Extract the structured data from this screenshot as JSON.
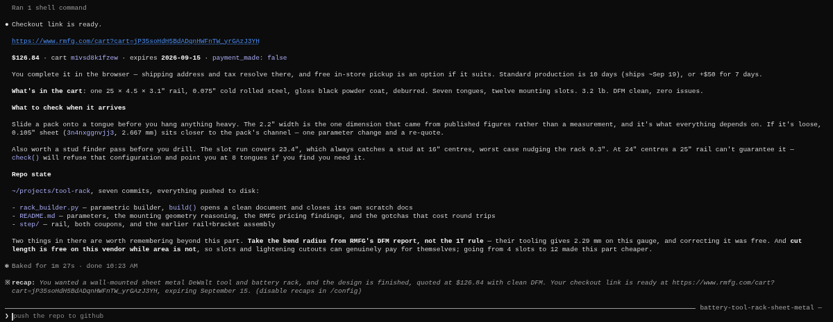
{
  "header": "Ran 1 shell command",
  "blocks": [
    {
      "kind": "bullet",
      "glyph": "●",
      "segments": [
        {
          "kind": "plain",
          "text": "Checkout link is ready."
        }
      ]
    },
    {
      "kind": "link",
      "text": "https://www.rmfg.com/cart?cart=jP35soHdH5BdADqnHWFnTW_yrGAzJ3YH"
    },
    {
      "kind": "para",
      "segments": [
        {
          "kind": "bold",
          "text": "$126.84"
        },
        {
          "kind": "plain",
          "text": " · cart "
        },
        {
          "kind": "code",
          "text": "m1vsd8k1fzew"
        },
        {
          "kind": "plain",
          "text": " · expires "
        },
        {
          "kind": "bold",
          "text": "2026-09-15"
        },
        {
          "kind": "plain",
          "text": " · "
        },
        {
          "kind": "code",
          "text": "payment_made: false"
        }
      ]
    },
    {
      "kind": "para",
      "segments": [
        {
          "kind": "plain",
          "text": "You complete it in the browser — shipping address and tax resolve there, and free in-store pickup is an option if it suits. Standard production is 10 days (ships ~Sep 19), or +$50 for 7 days."
        }
      ]
    },
    {
      "kind": "para",
      "segments": [
        {
          "kind": "bold",
          "text": "What's in the cart"
        },
        {
          "kind": "plain",
          "text": ": one 25 × 4.5 × 3.1\" rail, 0.075\" cold rolled steel, gloss black powder coat, deburred. Seven tongues, twelve mounting slots. 3.2 lb. DFM clean, zero issues."
        }
      ]
    },
    {
      "kind": "heading",
      "text": "What to check when it arrives"
    },
    {
      "kind": "para",
      "segments": [
        {
          "kind": "plain",
          "text": "Slide a pack onto a tongue before you hang anything heavy. The 2.2\" width is the one dimension that came from published figures rather than a measurement, and it's what everything depends on. If it's loose, 0.105\" sheet ("
        },
        {
          "kind": "code",
          "text": "3n4nxggnvjj3"
        },
        {
          "kind": "plain",
          "text": ", 2.667 mm) sits closer to the pack's channel — one parameter change and a re-quote."
        }
      ]
    },
    {
      "kind": "para",
      "segments": [
        {
          "kind": "plain",
          "text": "Also worth a stud finder pass before you drill. The slot run covers 23.4\", which always catches a stud at 16\" centres, worst case nudging the rack 0.3\". At 24\" centres a 25\" rail can't guarantee it — "
        },
        {
          "kind": "code",
          "text": "check()"
        },
        {
          "kind": "plain",
          "text": " will refuse that configuration and point you at 8 tongues if you find you need it."
        }
      ]
    },
    {
      "kind": "heading",
      "text": "Repo state"
    },
    {
      "kind": "para",
      "segments": [
        {
          "kind": "code",
          "text": "~/projects/tool-rack"
        },
        {
          "kind": "plain",
          "text": ", seven commits, everything pushed to disk:"
        }
      ]
    },
    {
      "kind": "list",
      "items": [
        {
          "segments": [
            {
              "kind": "plain",
              "text": "- "
            },
            {
              "kind": "code",
              "text": "rack_builder.py"
            },
            {
              "kind": "plain",
              "text": " — parametric builder, "
            },
            {
              "kind": "code",
              "text": "build()"
            },
            {
              "kind": "plain",
              "text": " opens a clean document and closes its own scratch docs"
            }
          ]
        },
        {
          "segments": [
            {
              "kind": "plain",
              "text": "- "
            },
            {
              "kind": "code",
              "text": "README.md"
            },
            {
              "kind": "plain",
              "text": " — parameters, the mounting geometry reasoning, the RMFG pricing findings, and the gotchas that cost round trips"
            }
          ]
        },
        {
          "segments": [
            {
              "kind": "plain",
              "text": "- "
            },
            {
              "kind": "code",
              "text": "step/"
            },
            {
              "kind": "plain",
              "text": " — rail, both coupons, and the earlier rail+bracket assembly"
            }
          ]
        }
      ]
    },
    {
      "kind": "para",
      "segments": [
        {
          "kind": "plain",
          "text": "Two things in there are worth remembering beyond this part. "
        },
        {
          "kind": "bold",
          "text": "Take the bend radius from RMFG's DFM report, not the 1T rule"
        },
        {
          "kind": "plain",
          "text": " — their tooling gives 2.29 mm on this gauge, and correcting it was free. And "
        },
        {
          "kind": "bold",
          "text": "cut length is free on this vendor while area is not"
        },
        {
          "kind": "plain",
          "text": ", so slots and lightening cutouts can genuinely pay for themselves; going from 4 slots to 12 made this part cheaper."
        }
      ]
    },
    {
      "kind": "status",
      "glyph": "✻",
      "text": "Baked for 1m 27s · done 10:23 AM"
    },
    {
      "kind": "recap",
      "glyph": "※",
      "label": "recap:",
      "text": "You wanted a wall-mounted sheet metal DeWalt tool and battery rack, and the design is finished, quoted at $126.84 with clean DFM. Your checkout link is ready at https://www.rmfg.com/cart?cart=jP35soHdH5BdADqnHWFnTW_yrGAzJ3YH, expiring September 15. (disable recaps in /config)"
    }
  ],
  "divider": {
    "title": "battery-tool-rack-sheet-metal —"
  },
  "prompt": {
    "glyph": "❯",
    "placeholder": "push the repo to github"
  }
}
